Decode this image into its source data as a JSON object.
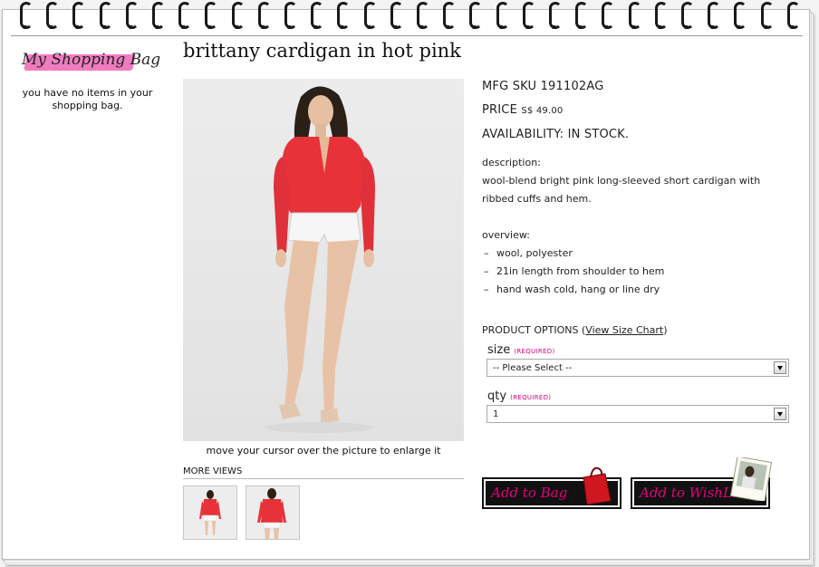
{
  "sidebar": {
    "bag_title": "My Shopping Bag",
    "empty_message": "you have no items in your shopping bag."
  },
  "product": {
    "title": "brittany cardigan in hot pink",
    "sku_text": "MFG SKU 191102AG",
    "price_label": "PRICE",
    "price_currency": "S$",
    "price_value": "49.00",
    "availability": "AVAILABILITY: IN STOCK.",
    "description_heading": "description:",
    "description_body": "wool-blend bright pink long-sleeved short cardigan with ribbed cuffs and hem.",
    "overview_heading": "overview:",
    "overview_items": [
      "wool, polyester",
      "21in length from shoulder to hem",
      "hand wash cold, hang or line dry"
    ],
    "bullet_char": "–"
  },
  "image": {
    "hint": "move your cursor over the picture to enlarge it",
    "more_views_label": "MORE VIEWS"
  },
  "options": {
    "heading": "PRODUCT OPTIONS",
    "size_chart_link": "View Size Chart",
    "size_label": "size",
    "size_required": "(REQUIRED)",
    "size_selected": "-- Please Select --",
    "qty_label": "qty",
    "qty_required": "(REQUIRED)",
    "qty_selected": "1"
  },
  "actions": {
    "add_to_bag": "Add to Bag",
    "add_to_wishlist": "Add to WishList"
  },
  "colors": {
    "accent_pink": "#e5007e",
    "cardigan": "#e8323a"
  }
}
